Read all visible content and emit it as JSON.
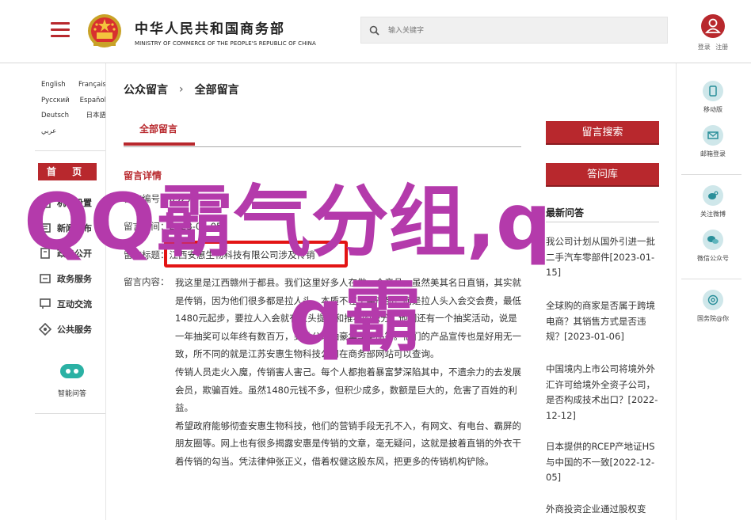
{
  "header": {
    "ministry_cn": "中华人民共和国商务部",
    "ministry_en": "MINISTRY OF COMMERCE OF THE PEOPLE'S REPUBLIC OF CHINA",
    "search_placeholder": "输入关键字",
    "login": "登录",
    "register": "注册"
  },
  "languages": [
    [
      "English",
      "Français"
    ],
    [
      "Русский",
      "Español"
    ],
    [
      "Deutsch",
      "日本語"
    ],
    [
      "عربي",
      ""
    ]
  ],
  "nav": {
    "home": "首 页",
    "items": [
      {
        "label": "机构设置",
        "icon": "org-icon"
      },
      {
        "label": "新闻发布",
        "icon": "news-icon"
      },
      {
        "label": "政务公开",
        "icon": "open-icon"
      },
      {
        "label": "政务服务",
        "icon": "service-icon"
      },
      {
        "label": "互动交流",
        "icon": "chat-icon"
      },
      {
        "label": "公共服务",
        "icon": "public-icon"
      }
    ],
    "robot_label": "智能问答"
  },
  "breadcrumb": {
    "root": "公众留言",
    "current": "全部留言"
  },
  "tab_active": "全部留言",
  "detail": {
    "title": "留言详情",
    "code_label": "留言编号：",
    "code_value": "6927",
    "time_label": "留言时间：",
    "time_value": "2023-01-05",
    "subject_label": "留言标题：",
    "subject_value": "江西安惠生物科技有限公司涉及传销",
    "content_label": "留言内容：",
    "paragraphs": [
      "我这里是江西赣州于都县。我们这里好多人在做一个产品，虽然美其名日直销，其实就是传销，因为他们很多都是拉人头，本质不在于卖产品，而是拉人头入会交会费，最低1480元起步，要拉人入会就有人头提成和推荐的积分，他们还有一个抽奖活动，说是一年抽奖可以年终有数百万，到总公司抽豪华车奖品等。他们的产品宣传也是好用无一致，所不同的就是江苏安惠生物科技公司在商务部网站可以查询。",
      "传销人员走火入魔，传销害人害己。每个人都抱着暴富梦深陷其中，不遗余力的去发展会员，欺骗百姓。虽然1480元钱不多，但积少成多，数额是巨大的，危害了百姓的利益。",
      "希望政府能够彻查安惠生物科技，他们的营销手段无孔不入，有网文、有电台、霸屏的朋友圈等。网上也有很多揭露安惠是传销的文章，毫无疑问，这就是披着直销的外衣干着传销的勾当。凭法律伸张正义，借着权健这股东风，把更多的传销机构铲除。"
    ]
  },
  "right": {
    "search_btn": "留言搜索",
    "faq_btn": "答问库",
    "latest_title": "最新问答",
    "news": [
      {
        "text": "我公司计划从国外引进一批二手汽车零部件",
        "date": "[2023-01-15]"
      },
      {
        "text": "全球购的商家是否属于跨境电商？其销售方式是否违规？",
        "date": "[2023-01-06]"
      },
      {
        "text": "中国境内上市公司将境外外汇许可给境外全资子公司，是否构成技术出口？",
        "date": "[2022-12-12]"
      },
      {
        "text": "日本提供的RCEP产地证HS与中国的不一致",
        "date": "[2022-12-05]"
      },
      {
        "text": "外商投资企业通过股权变",
        "date": ""
      }
    ]
  },
  "side": [
    {
      "label": "移动版",
      "icon": "mobile-icon"
    },
    {
      "label": "邮箱登录",
      "icon": "mail-icon"
    },
    {
      "label": "关注微博",
      "icon": "weibo-icon"
    },
    {
      "label": "微信公众号",
      "icon": "wechat-icon"
    },
    {
      "label": "国务院@你",
      "icon": "at-icon"
    }
  ],
  "watermark": {
    "line1": "QQ霸气分组,q",
    "line2": "q霸"
  },
  "colors": {
    "brand_red": "#b8282d",
    "watermark_purple": "#b43aab",
    "highlight_red": "#e31414",
    "side_icon_bg": "#cfe7ea"
  }
}
